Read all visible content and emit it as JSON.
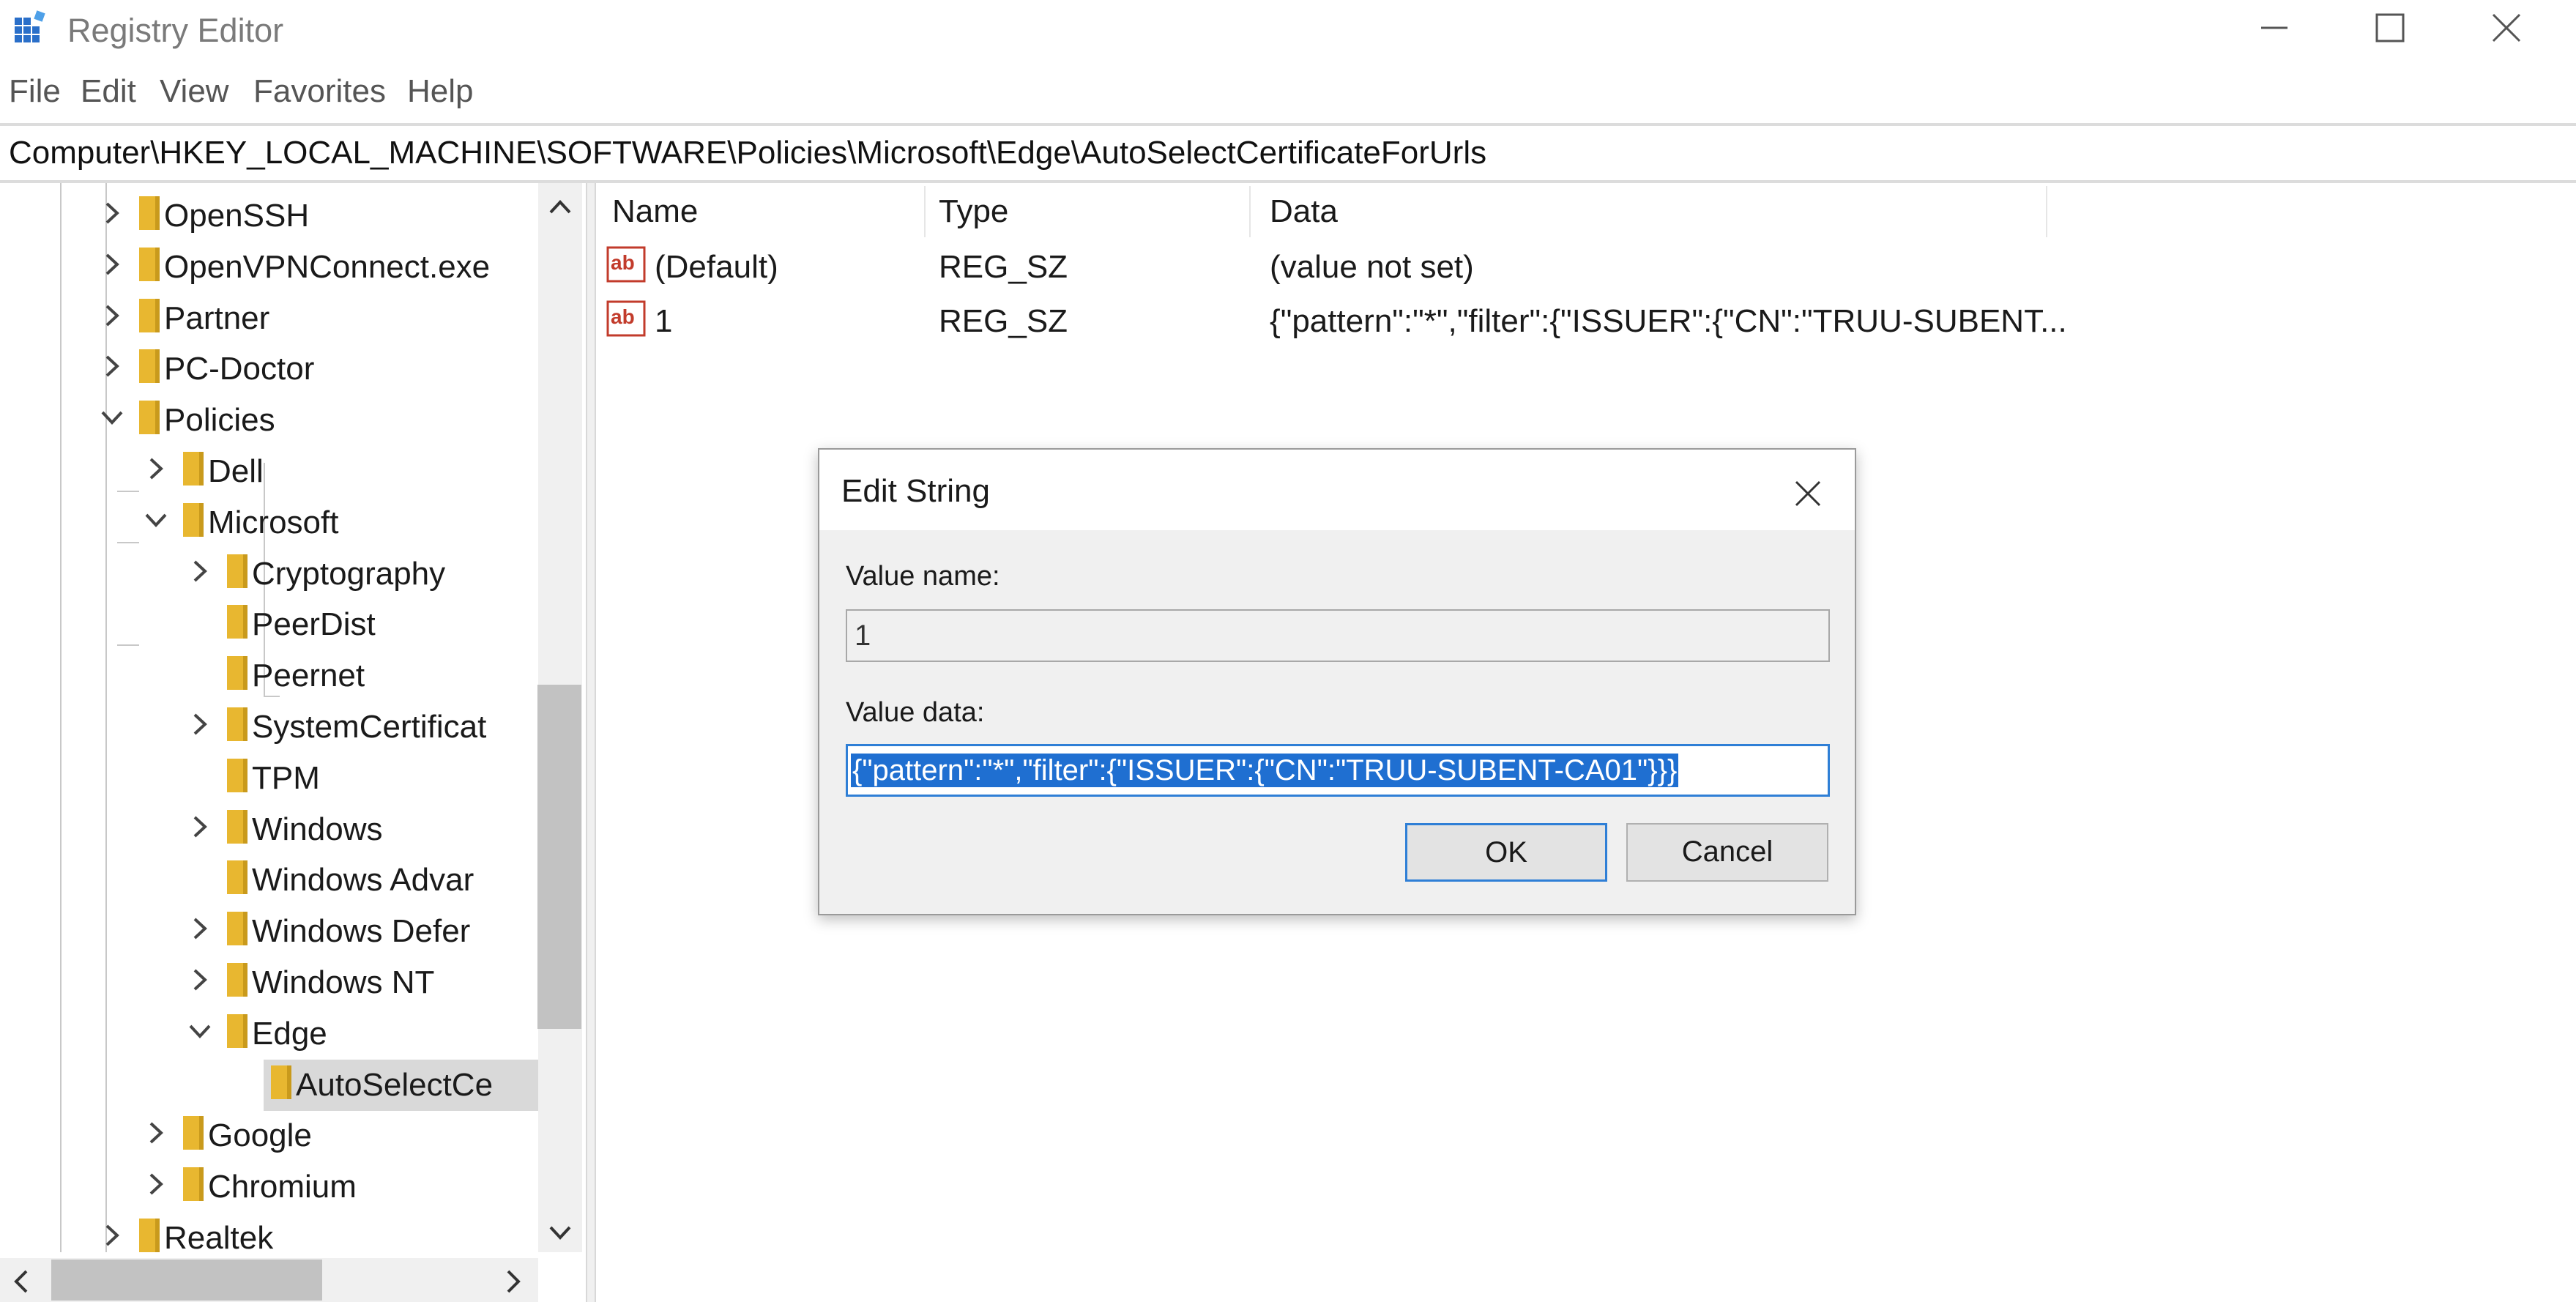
{
  "window": {
    "title": "Registry Editor"
  },
  "menu": {
    "items": [
      "File",
      "Edit",
      "View",
      "Favorites",
      "Help"
    ]
  },
  "address": {
    "path": "Computer\\HKEY_LOCAL_MACHINE\\SOFTWARE\\Policies\\Microsoft\\Edge\\AutoSelectCertificateForUrls"
  },
  "tree": {
    "items": [
      {
        "label": "OpenSSH",
        "level": 0,
        "expander": "collapsed"
      },
      {
        "label": "OpenVPNConnect.exe",
        "level": 0,
        "expander": "collapsed"
      },
      {
        "label": "Partner",
        "level": 0,
        "expander": "collapsed"
      },
      {
        "label": "PC-Doctor",
        "level": 0,
        "expander": "collapsed"
      },
      {
        "label": "Policies",
        "level": 0,
        "expander": "expanded"
      },
      {
        "label": "Dell",
        "level": 1,
        "expander": "collapsed"
      },
      {
        "label": "Microsoft",
        "level": 1,
        "expander": "expanded"
      },
      {
        "label": "Cryptography",
        "level": 2,
        "expander": "collapsed"
      },
      {
        "label": "PeerDist",
        "level": 2,
        "expander": "none"
      },
      {
        "label": "Peernet",
        "level": 2,
        "expander": "none"
      },
      {
        "label": "SystemCertificat",
        "level": 2,
        "expander": "collapsed"
      },
      {
        "label": "TPM",
        "level": 2,
        "expander": "none"
      },
      {
        "label": "Windows",
        "level": 2,
        "expander": "collapsed"
      },
      {
        "label": "Windows Advar",
        "level": 2,
        "expander": "none"
      },
      {
        "label": "Windows Defer",
        "level": 2,
        "expander": "collapsed"
      },
      {
        "label": "Windows NT",
        "level": 2,
        "expander": "collapsed"
      },
      {
        "label": "Edge",
        "level": 2,
        "expander": "expanded"
      },
      {
        "label": "AutoSelectCe",
        "level": 3,
        "expander": "none",
        "selected": true
      },
      {
        "label": "Google",
        "level": 1,
        "expander": "collapsed"
      },
      {
        "label": "Chromium",
        "level": 1,
        "expander": "collapsed"
      },
      {
        "label": "Realtek",
        "level": 0,
        "expander": "collapsed"
      }
    ]
  },
  "list": {
    "columns": [
      "Name",
      "Type",
      "Data"
    ],
    "rows": [
      {
        "name": "(Default)",
        "type": "REG_SZ",
        "data": "(value not set)",
        "icon": "string-value-icon"
      },
      {
        "name": "1",
        "type": "REG_SZ",
        "data": "{\"pattern\":\"*\",\"filter\":{\"ISSUER\":{\"CN\":\"TRUU-SUBENT...",
        "icon": "string-value-icon"
      }
    ]
  },
  "dialog": {
    "title": "Edit String",
    "value_name_label": "Value name:",
    "value_name": "1",
    "value_data_label": "Value data:",
    "value_data": "{\"pattern\":\"*\",\"filter\":{\"ISSUER\":{\"CN\":\"TRUU-SUBENT-CA01\"}}}",
    "ok_label": "OK",
    "cancel_label": "Cancel"
  },
  "colors": {
    "folder": "#e8b730",
    "selection": "#1f6fd1",
    "focus_border": "#2f7fd6",
    "tree_selected": "#d9d9d9"
  }
}
